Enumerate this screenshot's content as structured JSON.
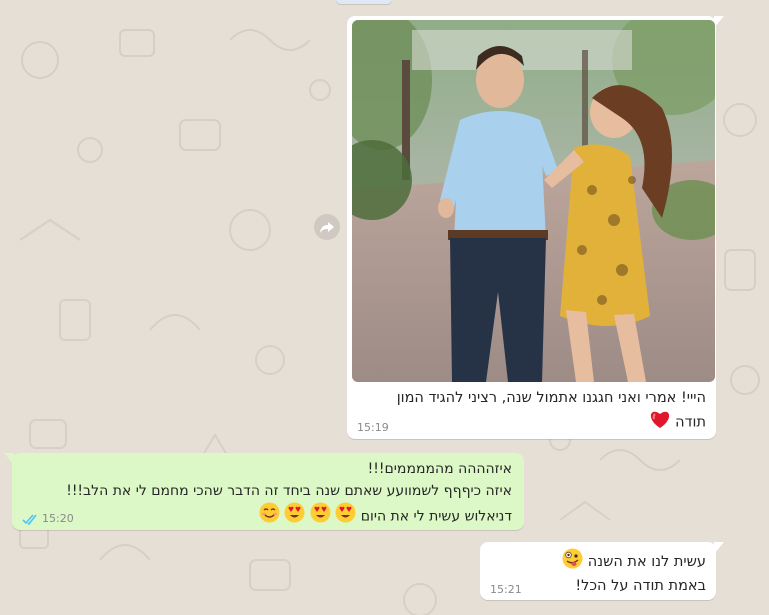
{
  "messages": [
    {
      "id": "photo-message",
      "direction": "incoming",
      "caption_line1": "הייי! אמרי ואני חגגנו אתמול שנה, רציני להגיד המון",
      "caption_line2": "תודה",
      "caption_emoji": "red-heart",
      "time": "15:19"
    },
    {
      "id": "reply-1",
      "direction": "outgoing",
      "line1": "איזהההה מהממממים!!!",
      "line2": "איזה כיףףף לשמוועע שאתם שנה ביחד זה הדבר שהכי מחמם לי את הלב!!!",
      "line3": "דניאלוש עשית לי את היום",
      "line3_emojis": [
        "heart-eyes",
        "heart-eyes",
        "heart-eyes",
        "smiling-face"
      ],
      "time": "15:20",
      "status": "read-double-check"
    },
    {
      "id": "photo-reply",
      "direction": "incoming",
      "line1": "עשית לנו את השנה",
      "line1_emoji": "zany-face",
      "line2": "באמת תודה על הכל!",
      "time": "15:21"
    }
  ],
  "colors": {
    "wallpaper": "#e6dfd6",
    "incoming_bubble": "#ffffff",
    "outgoing_bubble": "#dcf8c6",
    "read_ticks": "#4fc3f7",
    "heart": "#e0162b"
  }
}
